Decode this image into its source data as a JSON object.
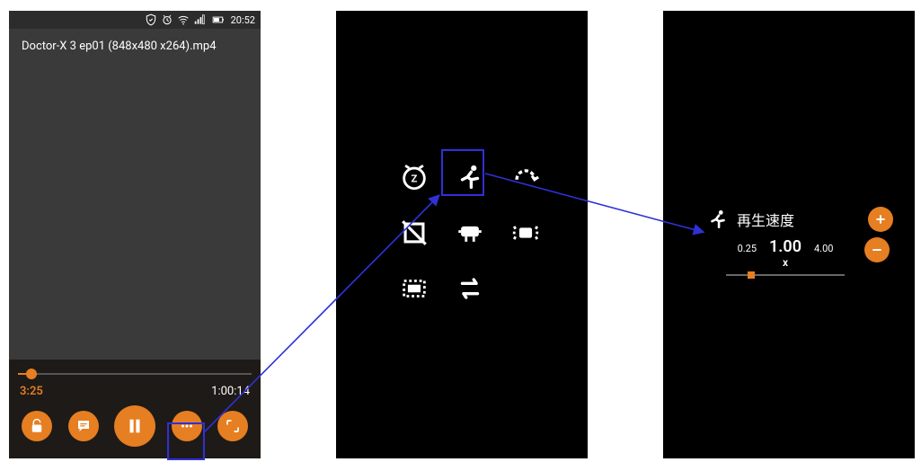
{
  "status": {
    "time": "20:52"
  },
  "player": {
    "file_title": "Doctor-X 3 ep01 (848x480 x264).mp4",
    "current_time": "3:25",
    "total_time": "1:00:14",
    "seek_percent": 5.7
  },
  "speed": {
    "title": "再生速度",
    "min": "0.25",
    "current": "1.00",
    "max": "4.00",
    "unit": "x"
  }
}
